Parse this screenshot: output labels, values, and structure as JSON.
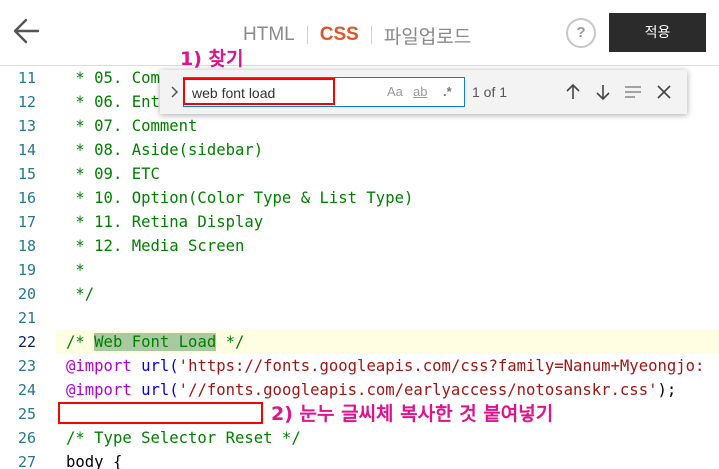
{
  "header": {
    "tabs": [
      {
        "label": "HTML",
        "active": false
      },
      {
        "label": "CSS",
        "active": true
      },
      {
        "label": "파일업로드",
        "active": false
      }
    ],
    "help_label": "?",
    "apply_label": "적용"
  },
  "colors": {
    "accent_tab": "#e2542b",
    "apply_button": "#2b2b2b",
    "annotation": "#e0138c",
    "annotation_box": "#ff0000",
    "comment": "#008000",
    "string": "#a31515",
    "keyword": "#af00db",
    "line_number": "#237893"
  },
  "find_widget": {
    "query": "web font load",
    "options": [
      "Aa",
      "ab",
      ".*"
    ],
    "match_count": "1 of 1",
    "icons": [
      "chevron-right-icon",
      "arrow-up-icon",
      "arrow-down-icon",
      "selection-icon",
      "close-icon"
    ]
  },
  "annotations": {
    "step1": "1) 찾기",
    "step2": "2) 눈누 글씨체 복사한 것 붙여넣기"
  },
  "editor": {
    "current_line": 22,
    "lines": [
      {
        "no": "11",
        "text": " * 05. Comment"
      },
      {
        "no": "12",
        "text": " * 06. Entry"
      },
      {
        "no": "13",
        "text": " * 07. Comment"
      },
      {
        "no": "14",
        "text": " * 08. Aside(sidebar)"
      },
      {
        "no": "15",
        "text": " * 09. ETC"
      },
      {
        "no": "16",
        "text": " * 10. Option(Color Type & List Type)"
      },
      {
        "no": "17",
        "text": " * 11. Retina Display"
      },
      {
        "no": "18",
        "text": " * 12. Media Screen"
      },
      {
        "no": "19",
        "text": " *"
      },
      {
        "no": "20",
        "text": " */"
      },
      {
        "no": "21",
        "text": ""
      },
      {
        "no": "22",
        "parts": {
          "open": "/* ",
          "match": "Web Font Load",
          "close": " */"
        }
      },
      {
        "no": "23",
        "parts": {
          "kw": "@import",
          "fn": " url(",
          "q1": "'",
          "str": "https://fonts.googleapis.com/css?family=Nanum+Myeongjo:",
          "tail": ""
        }
      },
      {
        "no": "24",
        "parts": {
          "kw": "@import",
          "fn": " url(",
          "q1": "'",
          "str": "//fonts.googleapis.com/earlyaccess/notosanskr.css",
          "q2": "'",
          "tail": ");"
        }
      },
      {
        "no": "25",
        "text": ""
      },
      {
        "no": "26",
        "text": "/* Type Selector Reset */"
      },
      {
        "no": "27",
        "text": "body {"
      }
    ]
  }
}
